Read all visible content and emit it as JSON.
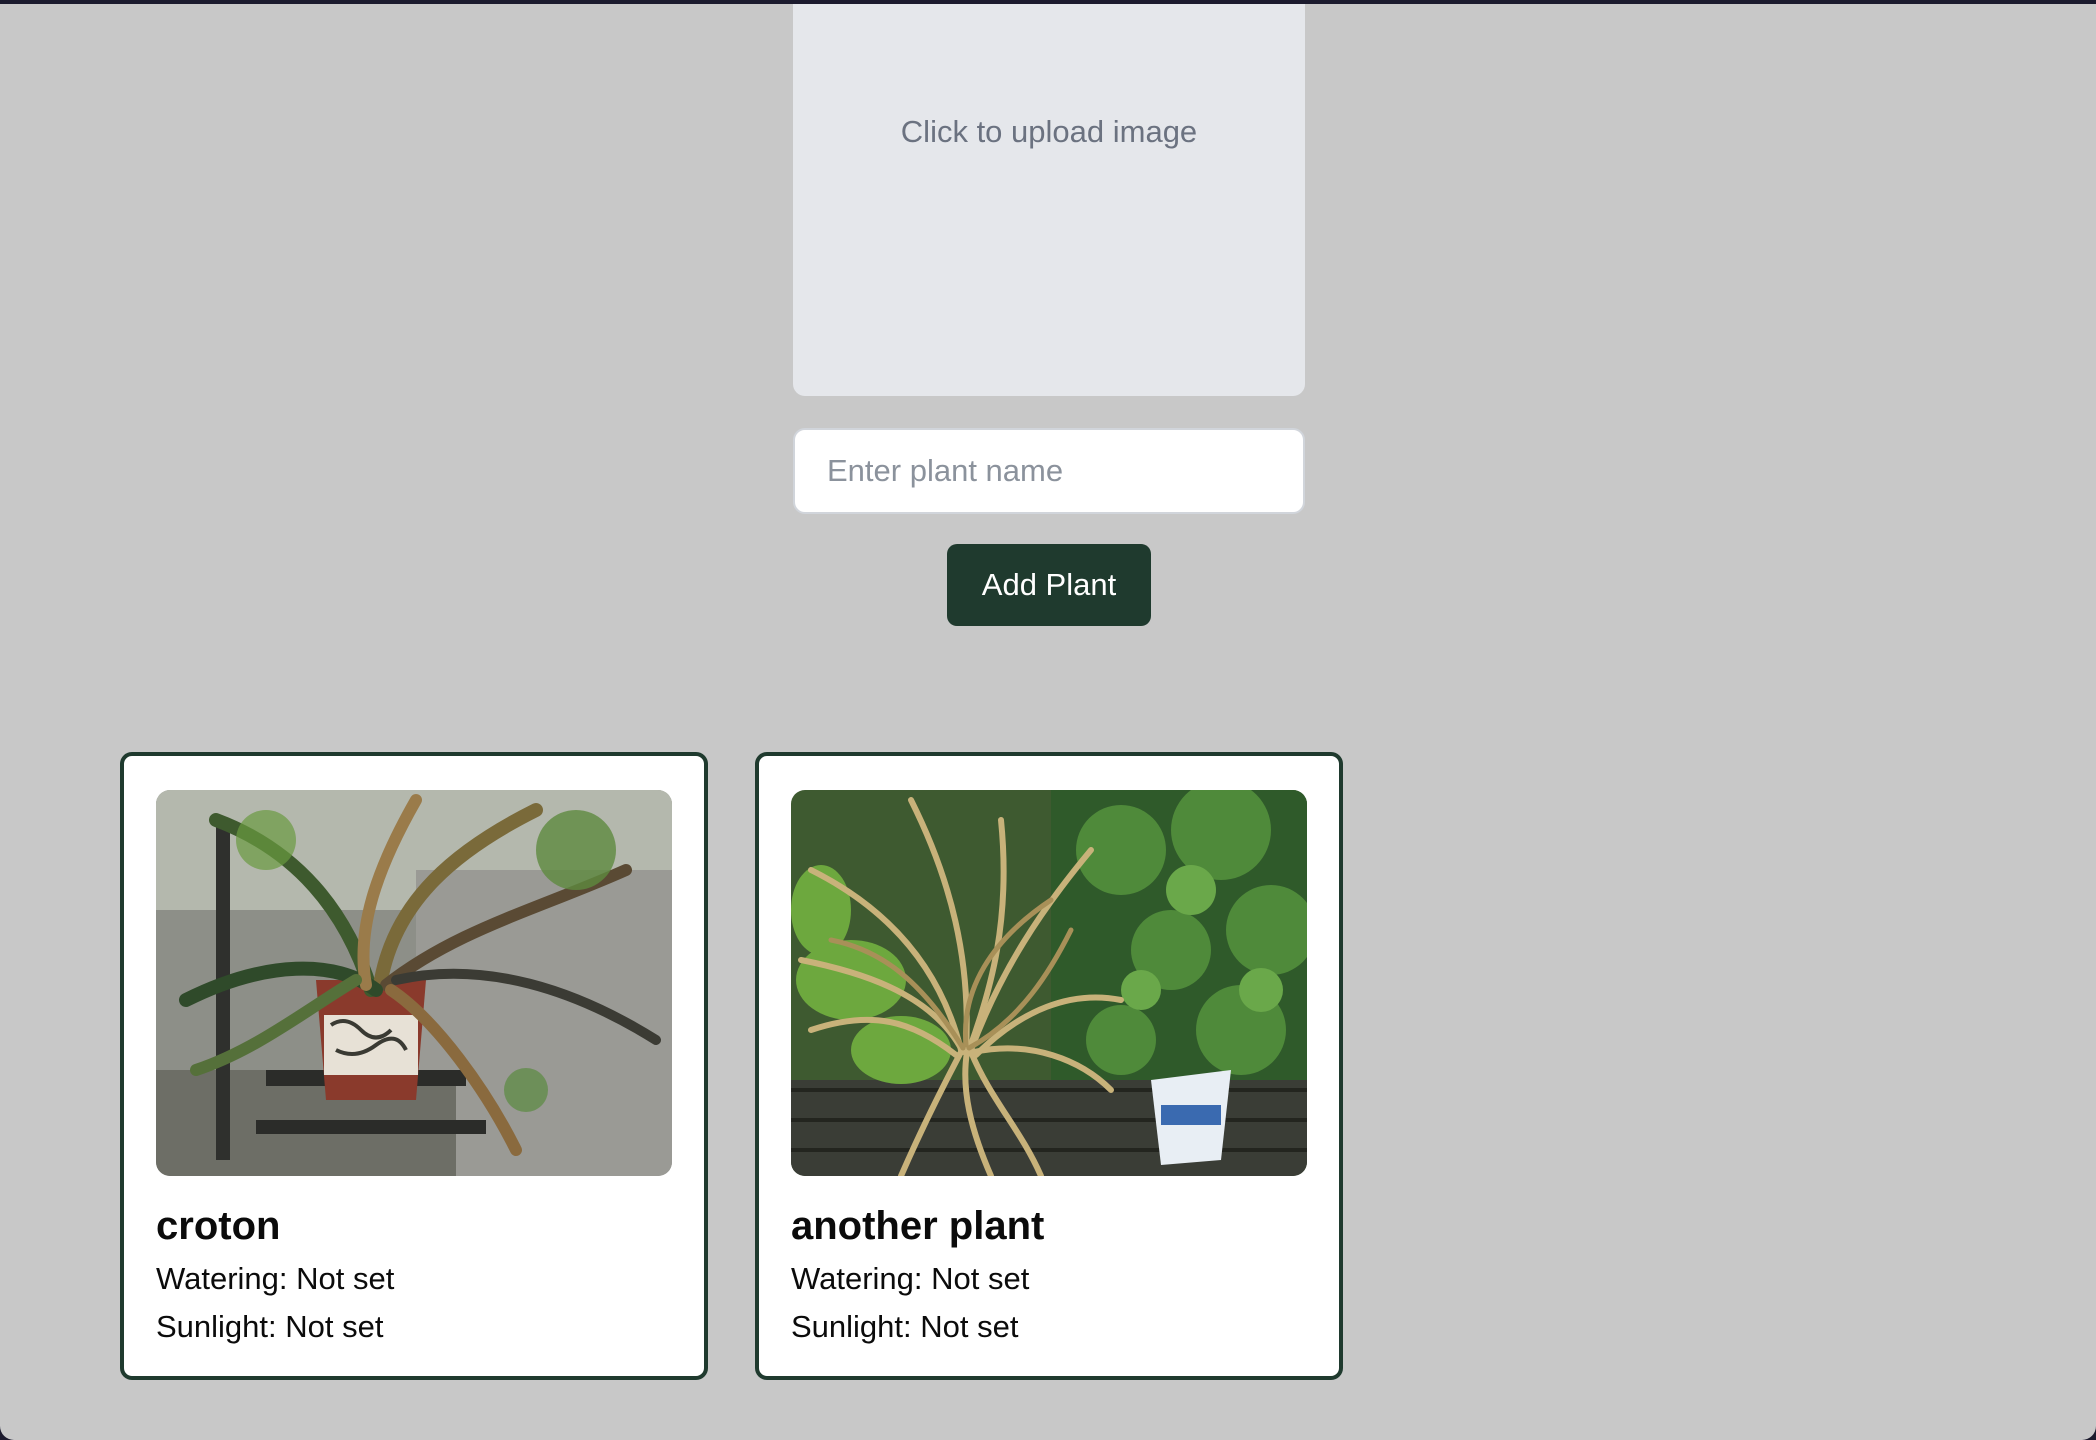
{
  "upload": {
    "prompt": "Click to upload image"
  },
  "form": {
    "name_placeholder": "Enter plant name",
    "name_value": "",
    "add_label": "Add Plant"
  },
  "plants": [
    {
      "name": "croton",
      "watering": "Watering: Not set",
      "sunlight": "Sunlight: Not set"
    },
    {
      "name": "another plant",
      "watering": "Watering: Not set",
      "sunlight": "Sunlight: Not set"
    }
  ],
  "colors": {
    "page_bg": "#c8c8c8",
    "upload_bg": "#e5e7eb",
    "accent": "#1f3a2e",
    "card_bg": "#ffffff"
  }
}
